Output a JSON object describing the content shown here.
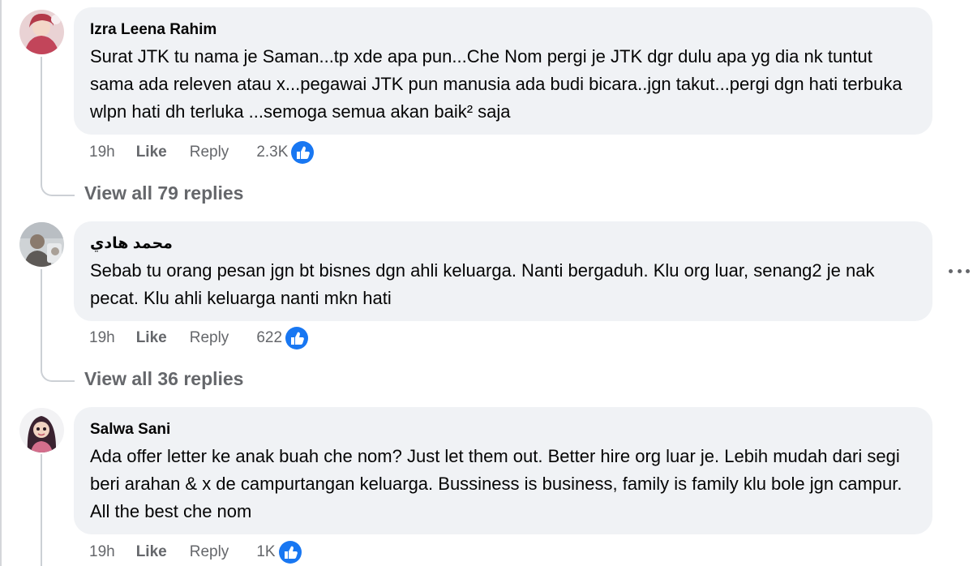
{
  "comments": [
    {
      "author": "Izra Leena Rahim",
      "text": "Surat JTK tu nama je Saman...tp xde apa pun...Che Nom pergi je JTK dgr dulu apa yg dia nk tuntut sama ada releven atau x...pegawai JTK pun manusia ada budi bicara..jgn takut...pergi dgn hati terbuka wlpn hati dh terluka ...semoga semua akan baik² saja",
      "time": "19h",
      "like_label": "Like",
      "reply_label": "Reply",
      "reaction_count": "2.3K",
      "view_replies": "View all 79 replies"
    },
    {
      "author": "محمد هادي",
      "text": "Sebab tu orang pesan jgn bt bisnes dgn ahli keluarga. Nanti bergaduh. Klu org luar, senang2 je nak pecat. Klu ahli keluarga nanti mkn hati",
      "time": "19h",
      "like_label": "Like",
      "reply_label": "Reply",
      "reaction_count": "622",
      "view_replies": "View all 36 replies"
    },
    {
      "author": "Salwa Sani",
      "text": "Ada offer letter ke anak buah che nom? Just let them out. Better hire org luar je. Lebih mudah dari segi beri arahan & x de campurtangan keluarga. Bussiness is business, family is family klu bole jgn campur. All the best che nom",
      "time": "19h",
      "like_label": "Like",
      "reply_label": "Reply",
      "reaction_count": "1K"
    }
  ],
  "colors": {
    "bubble": "#f0f2f5",
    "meta_text": "#65676b",
    "like_blue": "#1877f2",
    "thread_line": "#ccd0d5"
  },
  "icons": {
    "reaction": "thumbs-up-icon",
    "more": "more-options-icon"
  }
}
